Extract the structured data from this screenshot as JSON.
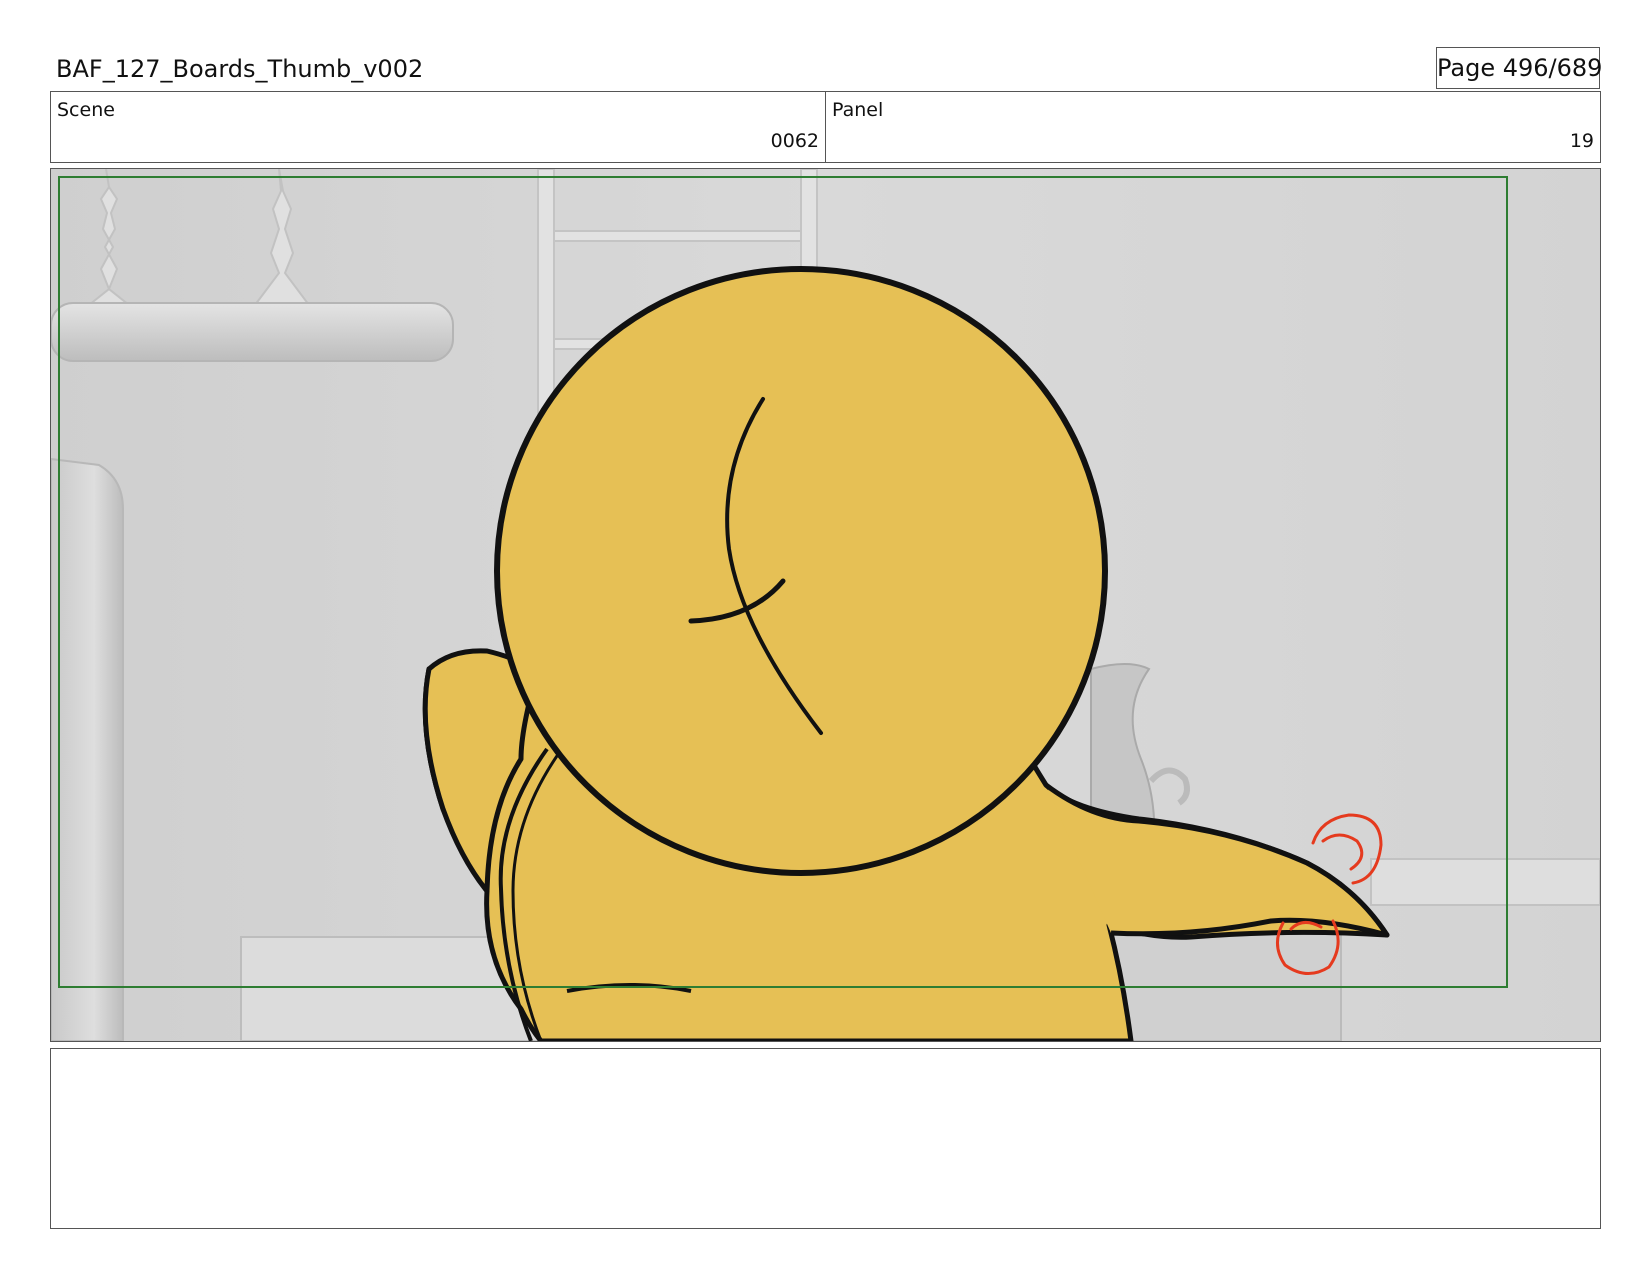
{
  "header": {
    "title": "BAF_127_Boards_Thumb_v002",
    "page_label": "Page 496/689"
  },
  "info": {
    "scene_label": "Scene",
    "scene_value": "0062",
    "panel_label": "Panel",
    "panel_value": "19"
  },
  "notes": {
    "text": ""
  },
  "colors": {
    "character_fill": "#e6c055",
    "background_gray": "#d6d6d6",
    "safe_frame_green": "#2e7d32",
    "sketch_red": "#e53a1e"
  }
}
